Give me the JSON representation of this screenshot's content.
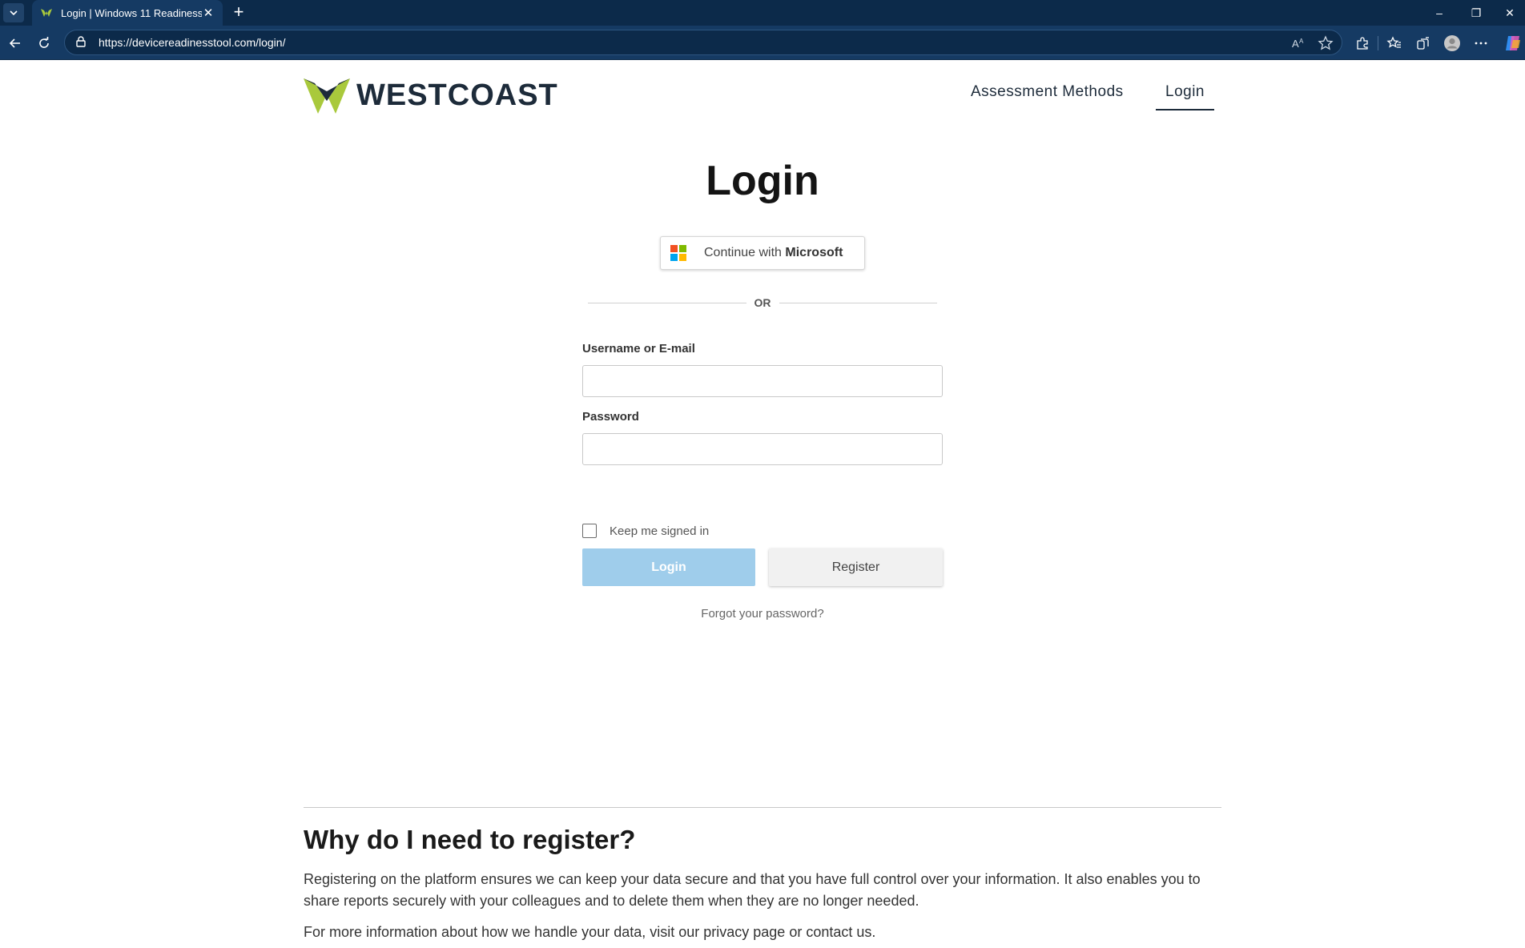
{
  "browser": {
    "tab": {
      "title": "Login | Windows 11 Readiness",
      "close_glyph": "✕",
      "favicon": "westcoast-favicon"
    },
    "new_tab_glyph": "+",
    "address": {
      "url": "https://devicereadinesstool.com/login/"
    },
    "window_controls": {
      "minimize": "–",
      "restore": "❐",
      "close": "✕"
    },
    "colors": {
      "tabbar": "#0c2a4a",
      "toolbar": "#153a63"
    }
  },
  "site": {
    "brand": "WESTCOAST",
    "nav": [
      {
        "label": "Assessment Methods"
      },
      {
        "label": "Login",
        "active": true
      }
    ],
    "colors": {
      "brand_green": "#a9c93c",
      "brand_dark": "#1d2b3a",
      "login_button": "#9fcdeb"
    }
  },
  "login": {
    "title": "Login",
    "microsoft_prefix": "Continue with ",
    "microsoft_name": "Microsoft",
    "or_text": "OR",
    "username_label": "Username or E-mail",
    "username_value": "",
    "password_label": "Password",
    "password_value": "",
    "keep_signed_in": "Keep me signed in",
    "keep_signed_in_checked": false,
    "login_button": "Login",
    "register_button": "Register",
    "forgot_link": "Forgot your password?"
  },
  "info": {
    "heading": "Why do I need to register?",
    "paragraph1": "Registering on the platform ensures we can keep your data secure and that you have full control over your information. It also enables you to share reports securely with your colleagues and to delete them when they are no longer needed.",
    "paragraph2": "For more information about how we handle your data, visit our privacy page or contact us."
  }
}
